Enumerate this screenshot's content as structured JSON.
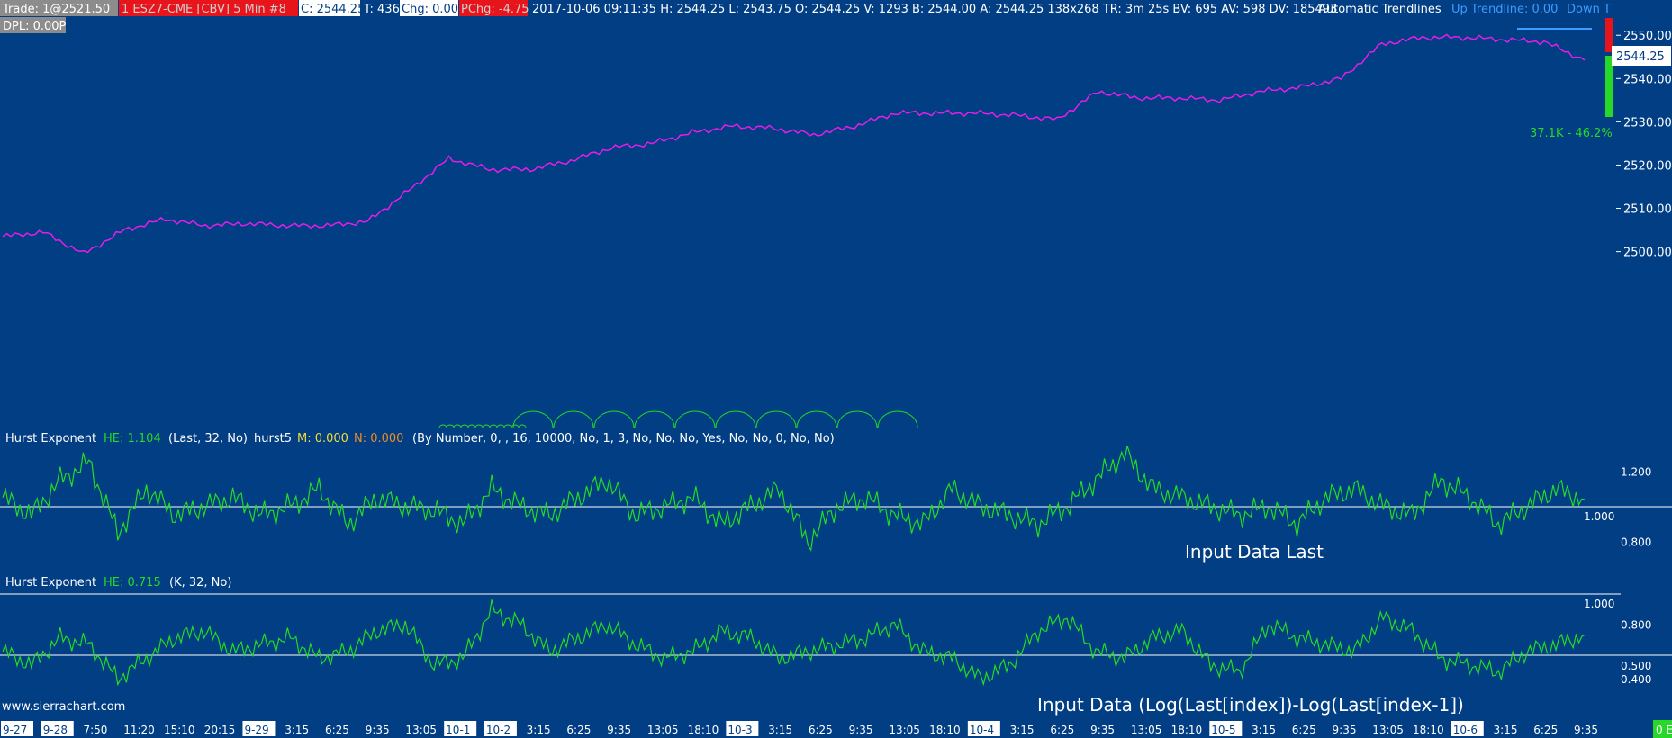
{
  "colors": {
    "background": "#013e83",
    "price_line": "#e81ce8",
    "indicator_line": "#22dd22",
    "red_box": "#e8141c",
    "white": "#ffffff",
    "blue_label": "#3c9cff",
    "yellow_label": "#f2dc3a",
    "orange_label": "#f08c28",
    "green_text": "#28d828"
  },
  "header": {
    "trade": "Trade: 1@2521.50",
    "symbol": "1 ESZ7-CME [CBV]  5 Min  #8",
    "close": "C: 2544.25",
    "ticks": "T: 436",
    "chg": "Chg: 0.00",
    "pchg": "PChg: -4.75",
    "stats": "2017-10-06 09:11:35 H: 2544.25 L: 2543.75 O: 2544.25 V: 1293 B: 2544.00 A: 2544.25 138x268 TR: 3m 25s BV: 695 AV: 598 DV: 185493",
    "trendlines": "Automatic Trendlines",
    "up_trendline": "Up Trendline: 0.00",
    "down_trendline": "Down T",
    "dpl": "DPL: 0.00P"
  },
  "price_panel": {
    "current_price": "2544.25",
    "volume_text": "37.1K - 46.2%"
  },
  "hurst1": {
    "name": "Hurst Exponent",
    "he": "HE: 1.104",
    "params": "(Last, 32, No)",
    "study": "hurst5",
    "m": "M: 0.000",
    "n": "N: 0.000",
    "args": "(By Number, 0, , 16, 10000, No, 1, 3, No, No, No, Yes, No, No, 0, No, No)",
    "note": "Input Data Last",
    "ref_label": "1.000"
  },
  "hurst2": {
    "name": "Hurst Exponent",
    "he": "HE: 0.715",
    "params": "(K, 32, No)",
    "note": "Input Data (Log(Last[index])-Log(Last[index-1])",
    "ref_label": "1.000"
  },
  "watermark": "www.sierrachart.com",
  "corner_badge": "0 E",
  "chart_data": [
    {
      "type": "line",
      "title": "1 ESZ7-CME [CBV]  5 Min  #8",
      "x": [
        "9-27",
        "9-28",
        "7:50",
        "11:20",
        "15:10",
        "20:15",
        "9-29",
        "3:15",
        "6:25",
        "9:35",
        "13:05",
        "10-1",
        "10-2",
        "3:15",
        "6:25",
        "9:35",
        "13:05",
        "18:10",
        "10-3",
        "3:15",
        "6:25",
        "9:35",
        "13:05",
        "18:10",
        "10-4",
        "3:15",
        "6:25",
        "9:35",
        "13:05",
        "18:10",
        "10-5",
        "3:15",
        "6:25",
        "9:35",
        "13:05",
        "18:10",
        "10-6",
        "3:15",
        "6:25",
        "9:35"
      ],
      "series": [
        {
          "values": [
            2503.5,
            2504.5,
            2499.5,
            2505,
            2507.5,
            2506,
            2506.5,
            2506,
            2506,
            2507,
            2514,
            2521.5,
            2519,
            2519,
            2521,
            2524,
            2525,
            2527.5,
            2529,
            2528.5,
            2527,
            2529,
            2532,
            2532,
            2532,
            2531.5,
            2530.5,
            2537,
            2535.5,
            2535.5,
            2535,
            2537,
            2538,
            2540,
            2548,
            2549.5,
            2549.5,
            2549,
            2548.5,
            2544.25
          ]
        }
      ],
      "y_ticks": [
        "2550.00",
        "2540.00",
        "2530.00",
        "2520.00",
        "2510.00",
        "2500.00"
      ],
      "ylim": [
        2476,
        2554
      ]
    },
    {
      "type": "line",
      "title": "Hurst Exponent",
      "series": [
        {
          "name": "HE",
          "values": [
            1.05,
            0.95,
            1.15,
            1.25,
            0.85,
            1.1,
            0.95,
            1.0,
            1.05,
            0.95,
            1.0,
            1.1,
            0.9,
            1.05,
            1.0,
            0.98,
            0.9,
            1.1,
            1.0,
            0.95,
            1.05,
            1.15,
            0.95,
            1.0,
            1.05,
            0.9,
            1.0,
            1.1,
            0.8,
            1.0,
            1.05,
            0.95,
            0.9,
            1.1,
            1.0,
            0.95,
            0.9,
            1.0,
            1.15,
            1.3,
            1.1,
            1.05,
            1.0,
            0.95,
            1.0,
            0.9,
            1.05,
            1.1,
            1.0,
            0.95,
            1.15,
            1.05,
            0.9,
            1.0,
            1.1,
            1.04
          ]
        }
      ],
      "y_ticks": [
        "1.200",
        "0.800"
      ],
      "ylim": [
        0.63,
        1.32
      ]
    },
    {
      "type": "line",
      "title": "Hurst Exponent",
      "series": [
        {
          "name": "HE",
          "values": [
            0.6,
            0.5,
            0.7,
            0.65,
            0.4,
            0.55,
            0.7,
            0.75,
            0.6,
            0.65,
            0.7,
            0.55,
            0.6,
            0.75,
            0.8,
            0.5,
            0.55,
            0.9,
            0.8,
            0.6,
            0.7,
            0.8,
            0.65,
            0.55,
            0.6,
            0.75,
            0.7,
            0.55,
            0.6,
            0.65,
            0.7,
            0.8,
            0.6,
            0.55,
            0.4,
            0.5,
            0.75,
            0.85,
            0.6,
            0.55,
            0.7,
            0.75,
            0.5,
            0.45,
            0.8,
            0.7,
            0.65,
            0.6,
            0.85,
            0.75,
            0.55,
            0.5,
            0.45,
            0.6,
            0.65,
            0.72
          ]
        }
      ],
      "y_ticks": [
        "0.800",
        "0.500",
        "0.400"
      ],
      "ylim": [
        0.13,
        1.02
      ]
    }
  ]
}
